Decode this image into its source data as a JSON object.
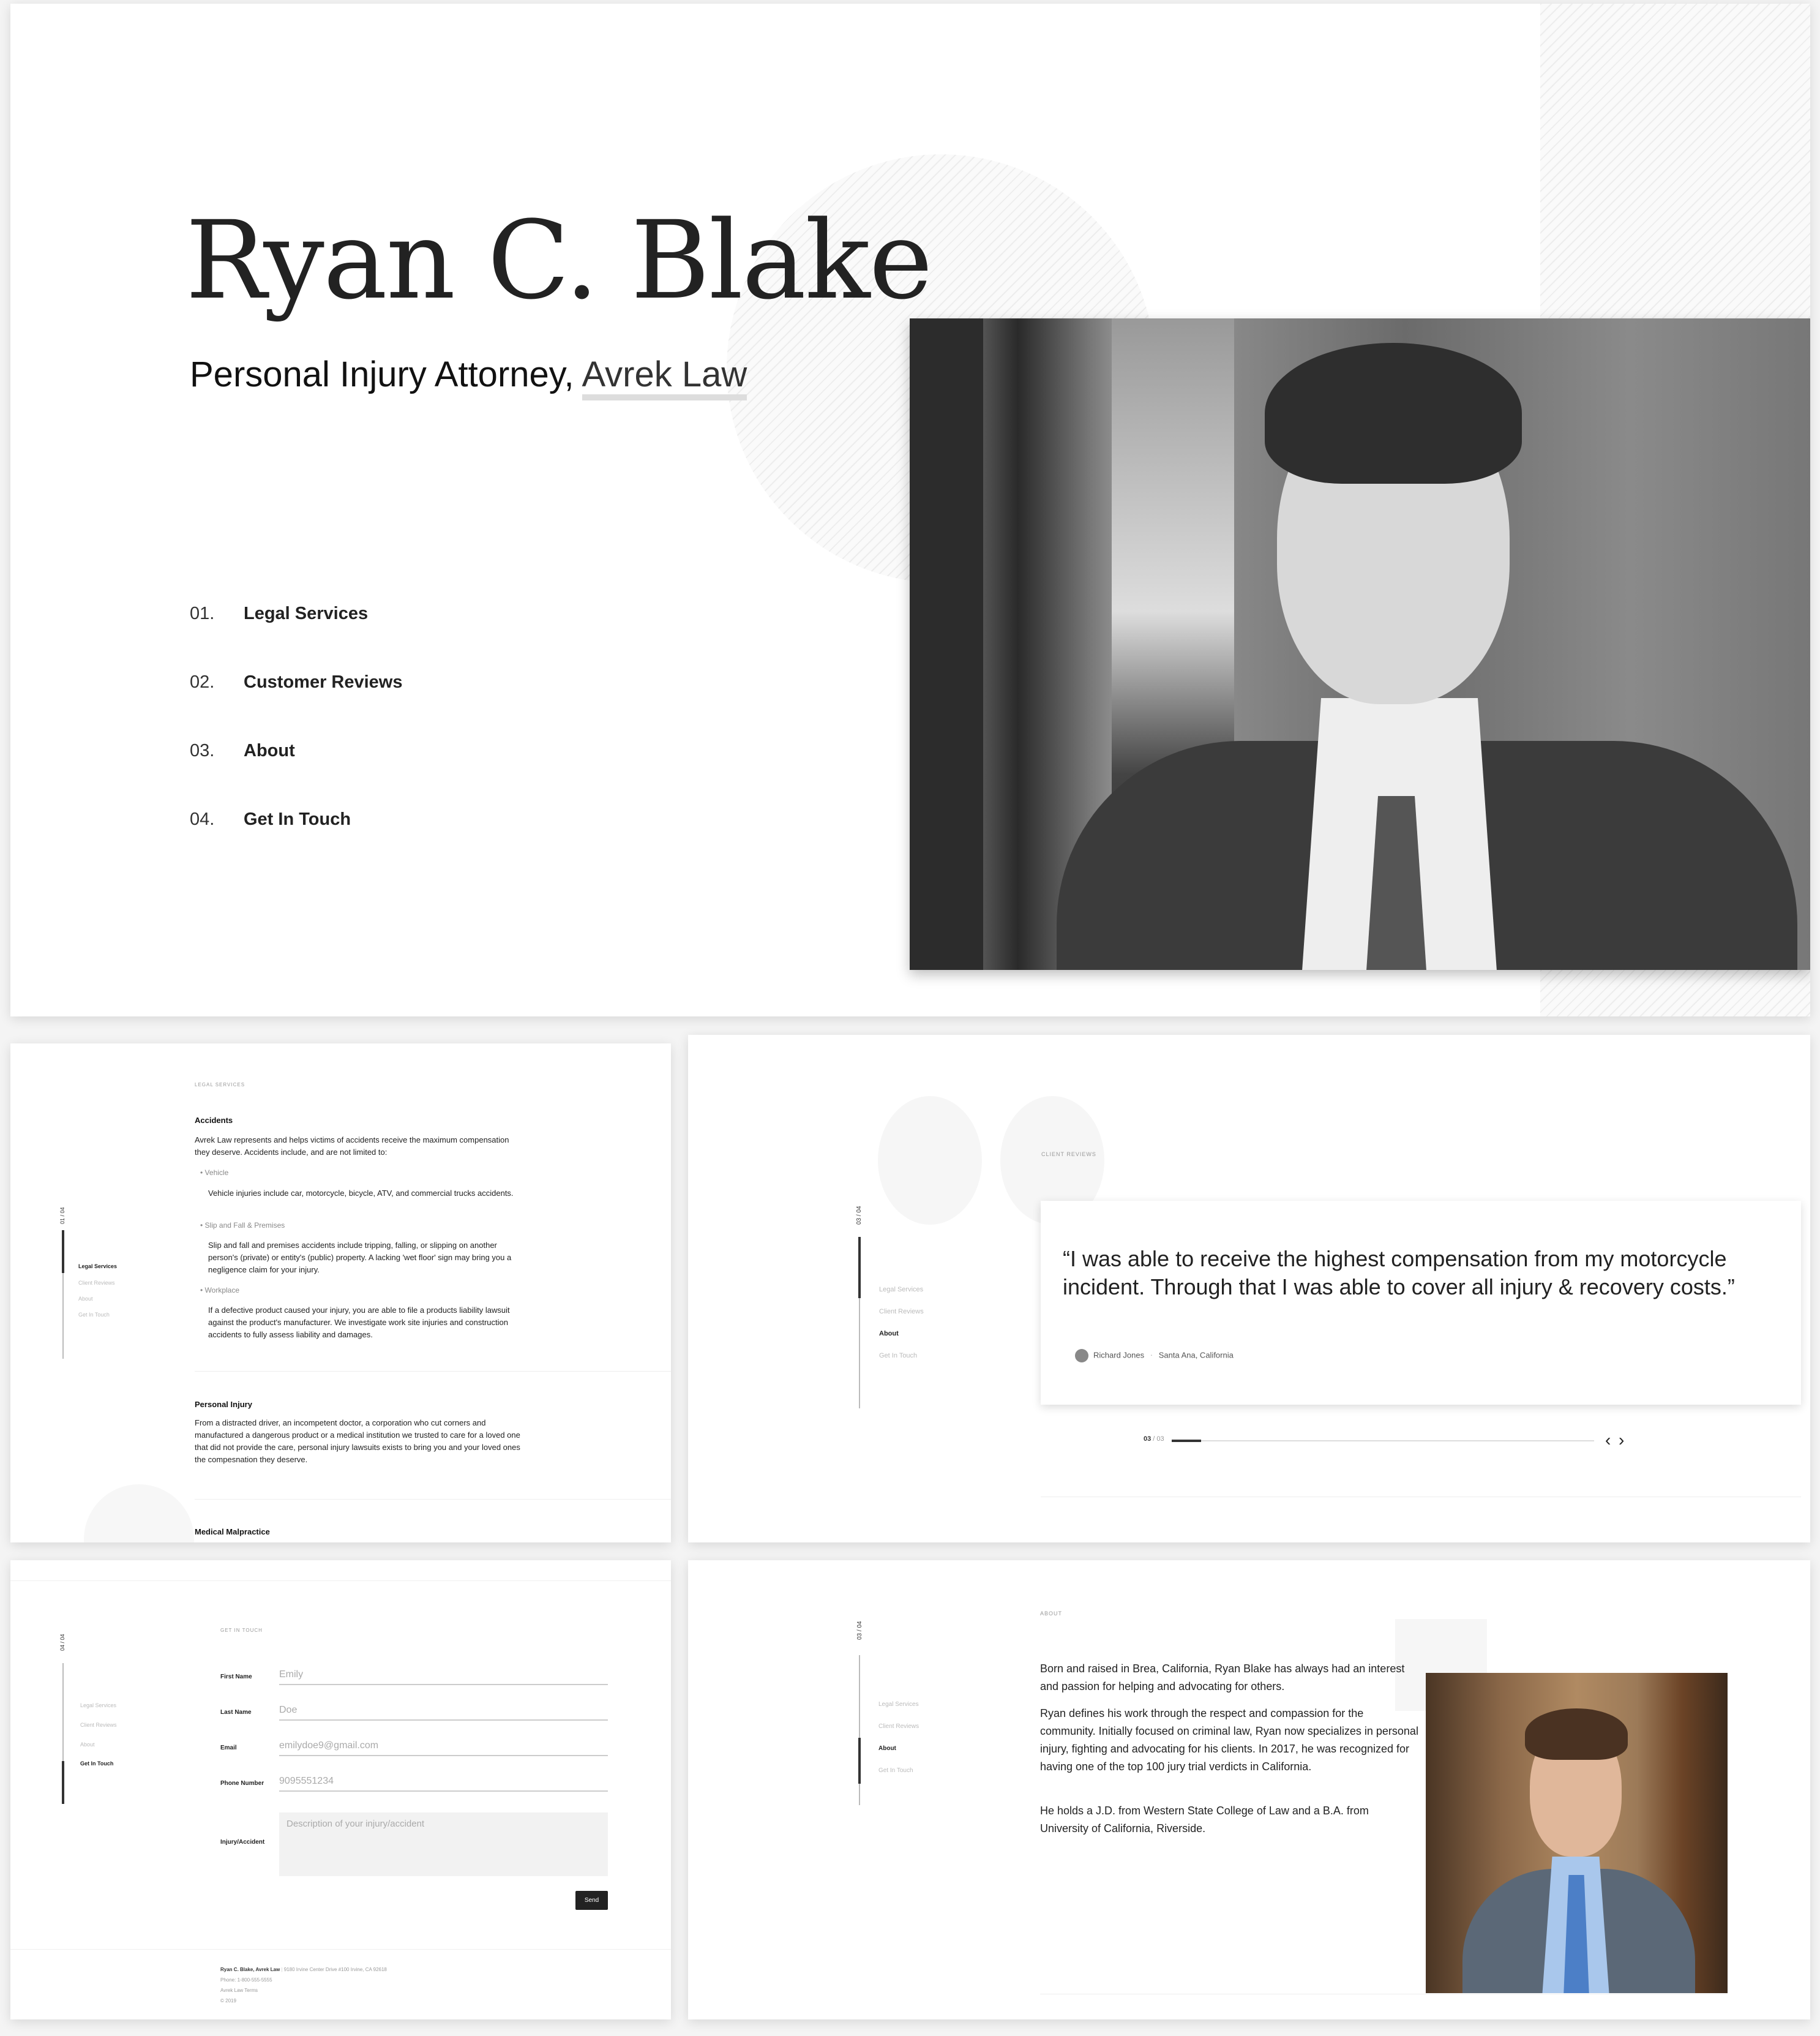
{
  "hero": {
    "name": "Ryan C. Blake",
    "subtitle_prefix": "Personal Injury Attorney, ",
    "subtitle_firm": "Avrek Law",
    "nav": [
      {
        "num": "01.",
        "label": "Legal Services"
      },
      {
        "num": "02.",
        "label": "Customer Reviews"
      },
      {
        "num": "03.",
        "label": "About"
      },
      {
        "num": "04.",
        "label": "Get In Touch"
      }
    ]
  },
  "side_nav": {
    "items": [
      "Legal Services",
      "Client Reviews",
      "About",
      "Get In Touch"
    ],
    "legal_counter": "01 / 04",
    "reviews_counter": "03 / 04",
    "contact_counter": "04 / 04",
    "about_counter": "03 / 04"
  },
  "legal": {
    "section_label": "LEGAL SERVICES",
    "accidents_title": "Accidents",
    "accidents_intro": "Avrek Law represents and helps victims of accidents receive the maximum compensation they deserve. Accidents include, and are not limited to:",
    "items": [
      {
        "label": "Vehicle",
        "text": "Vehicle injuries include car, motorcycle, bicycle, ATV, and commercial trucks accidents."
      },
      {
        "label": "Slip and Fall & Premises",
        "text": "Slip and fall and premises accidents include tripping, falling, or slipping on another person's (private) or entity's (public) property. A lacking 'wet floor' sign may bring you a negligence claim for your injury."
      },
      {
        "label": "Workplace",
        "text": "If a defective product caused your injury, you are able to file a products liability lawsuit against the product's manufacturer. We investigate work site injuries and construction accidents to fully assess liability and damages."
      }
    ],
    "personal_title": "Personal Injury",
    "personal_text": "From a distracted driver, an incompetent doctor, a corporation who cut corners and manufactured a dangerous product or a medical institution we trusted to care for a loved one that did not provide the care, personal injury lawsuits exists to bring you and your loved ones the compesnation they deserve.",
    "malpractice_title": "Medical Malpractice"
  },
  "reviews": {
    "section_label": "CLIENT REVIEWS",
    "quote": "“I was able to receive the highest compensation from my motorcycle incident. Through that I was able to cover all injury & recovery costs.”",
    "author": "Richard Jones",
    "separator": "·",
    "location": "Santa Ana, California",
    "pager_current": "03",
    "pager_total": " / 03",
    "progress": 0.07
  },
  "contact": {
    "section_label": "GET IN TOUCH",
    "fields": [
      {
        "label": "First Name",
        "value": "Emily"
      },
      {
        "label": "Last Name",
        "value": "Doe"
      },
      {
        "label": "Email",
        "value": "emilydoe9@gmail.com"
      },
      {
        "label": "Phone Number",
        "value": "9095551234"
      }
    ],
    "injury_label": "Injury/Accident",
    "injury_placeholder": "Description of your injury/accident",
    "send_label": "Send",
    "footer_name": "Ryan C. Blake, Avrek Law",
    "footer_address": "9180 Irvine Center Drive #100 Irvine, CA 92618",
    "footer_phone": "Phone: 1-800-555-5555",
    "footer_terms": "Avrek Law Terms",
    "footer_copy": "© 2019"
  },
  "about": {
    "section_label": "ABOUT",
    "paragraphs": [
      "Born and raised in Brea, California, Ryan Blake has always had an interest and passion for helping and advocating for others.",
      "Ryan defines his work through the respect and compassion for the community. Initially focused on criminal law, Ryan now specializes in personal injury, fighting and advocating for his clients. In 2017, he was recognized for having one of the top 100 jury trial verdicts in California.",
      "He holds a J.D. from Western State College of Law and a B.A. from University of California, Riverside."
    ]
  }
}
